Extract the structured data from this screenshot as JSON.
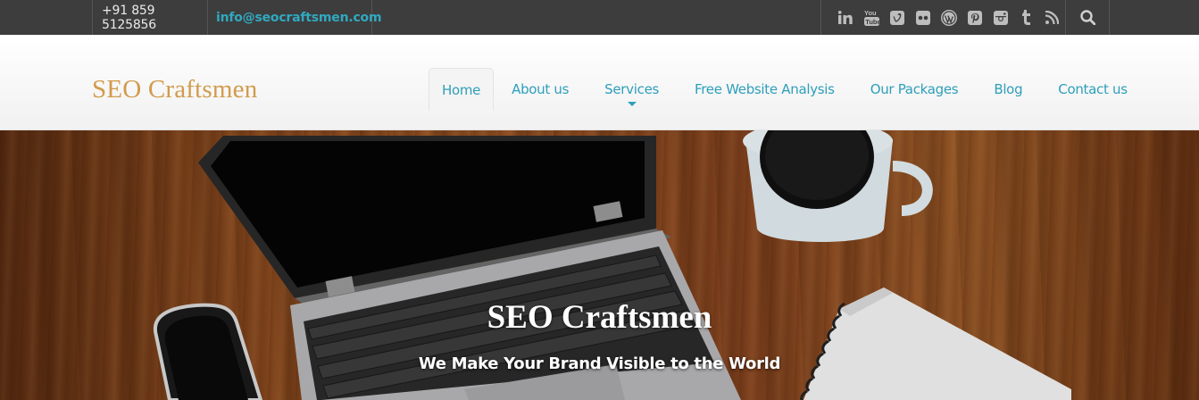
{
  "topbar": {
    "phone": "+91 859 5125856",
    "email": "info@seocraftsmen.com",
    "social_icons": [
      "linkedin-icon",
      "youtube-icon",
      "vimeo-icon",
      "flickr-icon",
      "wordpress-icon",
      "pinterest-icon",
      "instagram-icon",
      "tumblr-icon",
      "rss-icon"
    ],
    "search_icon": "search-icon"
  },
  "header": {
    "logo": "SEO Craftsmen",
    "nav": [
      {
        "label": "Home",
        "active": true
      },
      {
        "label": "About us"
      },
      {
        "label": "Services",
        "has_dropdown": true
      },
      {
        "label": "Free Website Analysis"
      },
      {
        "label": "Our Packages"
      },
      {
        "label": "Blog"
      },
      {
        "label": "Contact us"
      }
    ]
  },
  "hero": {
    "title": "SEO Craftsmen",
    "tagline": "We Make Your Brand Visible to the World"
  },
  "colors": {
    "topbar_bg": "#3d3d3d",
    "accent": "#2e9fba",
    "logo": "#d19b4c"
  }
}
